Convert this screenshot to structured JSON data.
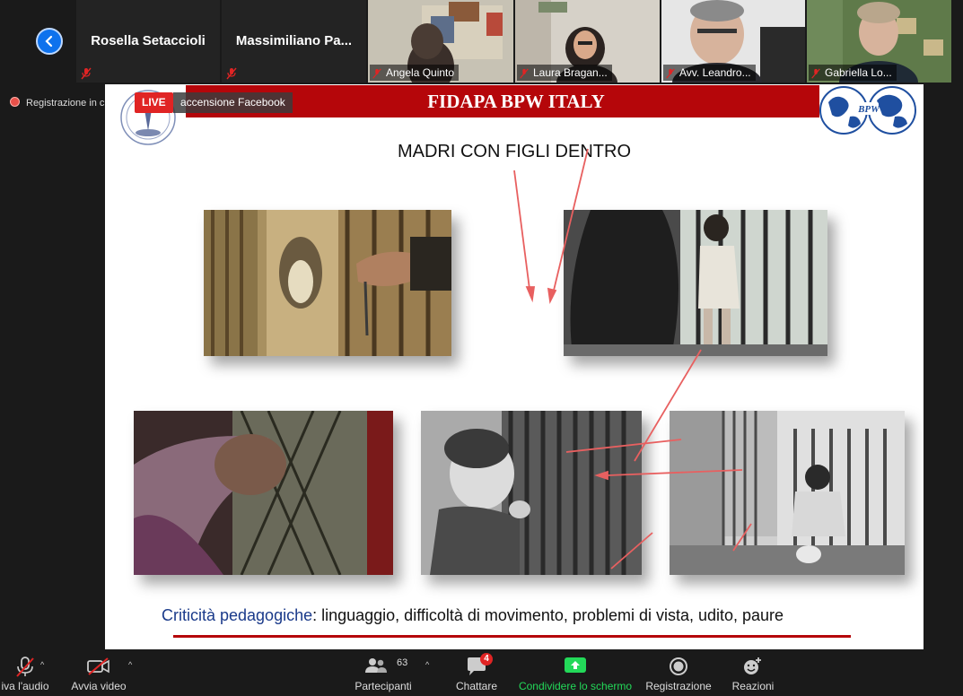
{
  "participants_strip": {
    "tiles": [
      {
        "name": "Rosella Setaccioli"
      },
      {
        "name": "Massimiliano  Pa..."
      },
      {
        "name": "Angela Quinto"
      },
      {
        "name": "Laura Bragan..."
      },
      {
        "name": "Avv. Leandro..."
      },
      {
        "name": "Gabriella Lo..."
      }
    ]
  },
  "recording": {
    "text": "Registrazione in c"
  },
  "live_badge": {
    "label": "LIVE",
    "text": "accensione Facebook"
  },
  "slide": {
    "banner": "FIDAPA BPW ITALY",
    "logo_text": "BPW",
    "heading": "MADRI CON FIGLI DENTRO",
    "caption_highlight": "Criticità pedagogiche",
    "caption_rest": ": linguaggio, difficoltà di movimento, problemi di vista, udito, paure"
  },
  "toolbar": {
    "audio": "iva l'audio",
    "video": "Avvia video",
    "participants": "Partecipanti",
    "participants_count": "63",
    "chat": "Chattare",
    "chat_badge": "4",
    "share": "Condividere lo schermo",
    "record": "Registrazione",
    "reactions": "Reazioni"
  },
  "colors": {
    "accent_blue": "#0e72ed",
    "share_green": "#23d959",
    "banner_red": "#b5060a",
    "live_red": "#e02424",
    "muted_red": "#e02424"
  }
}
